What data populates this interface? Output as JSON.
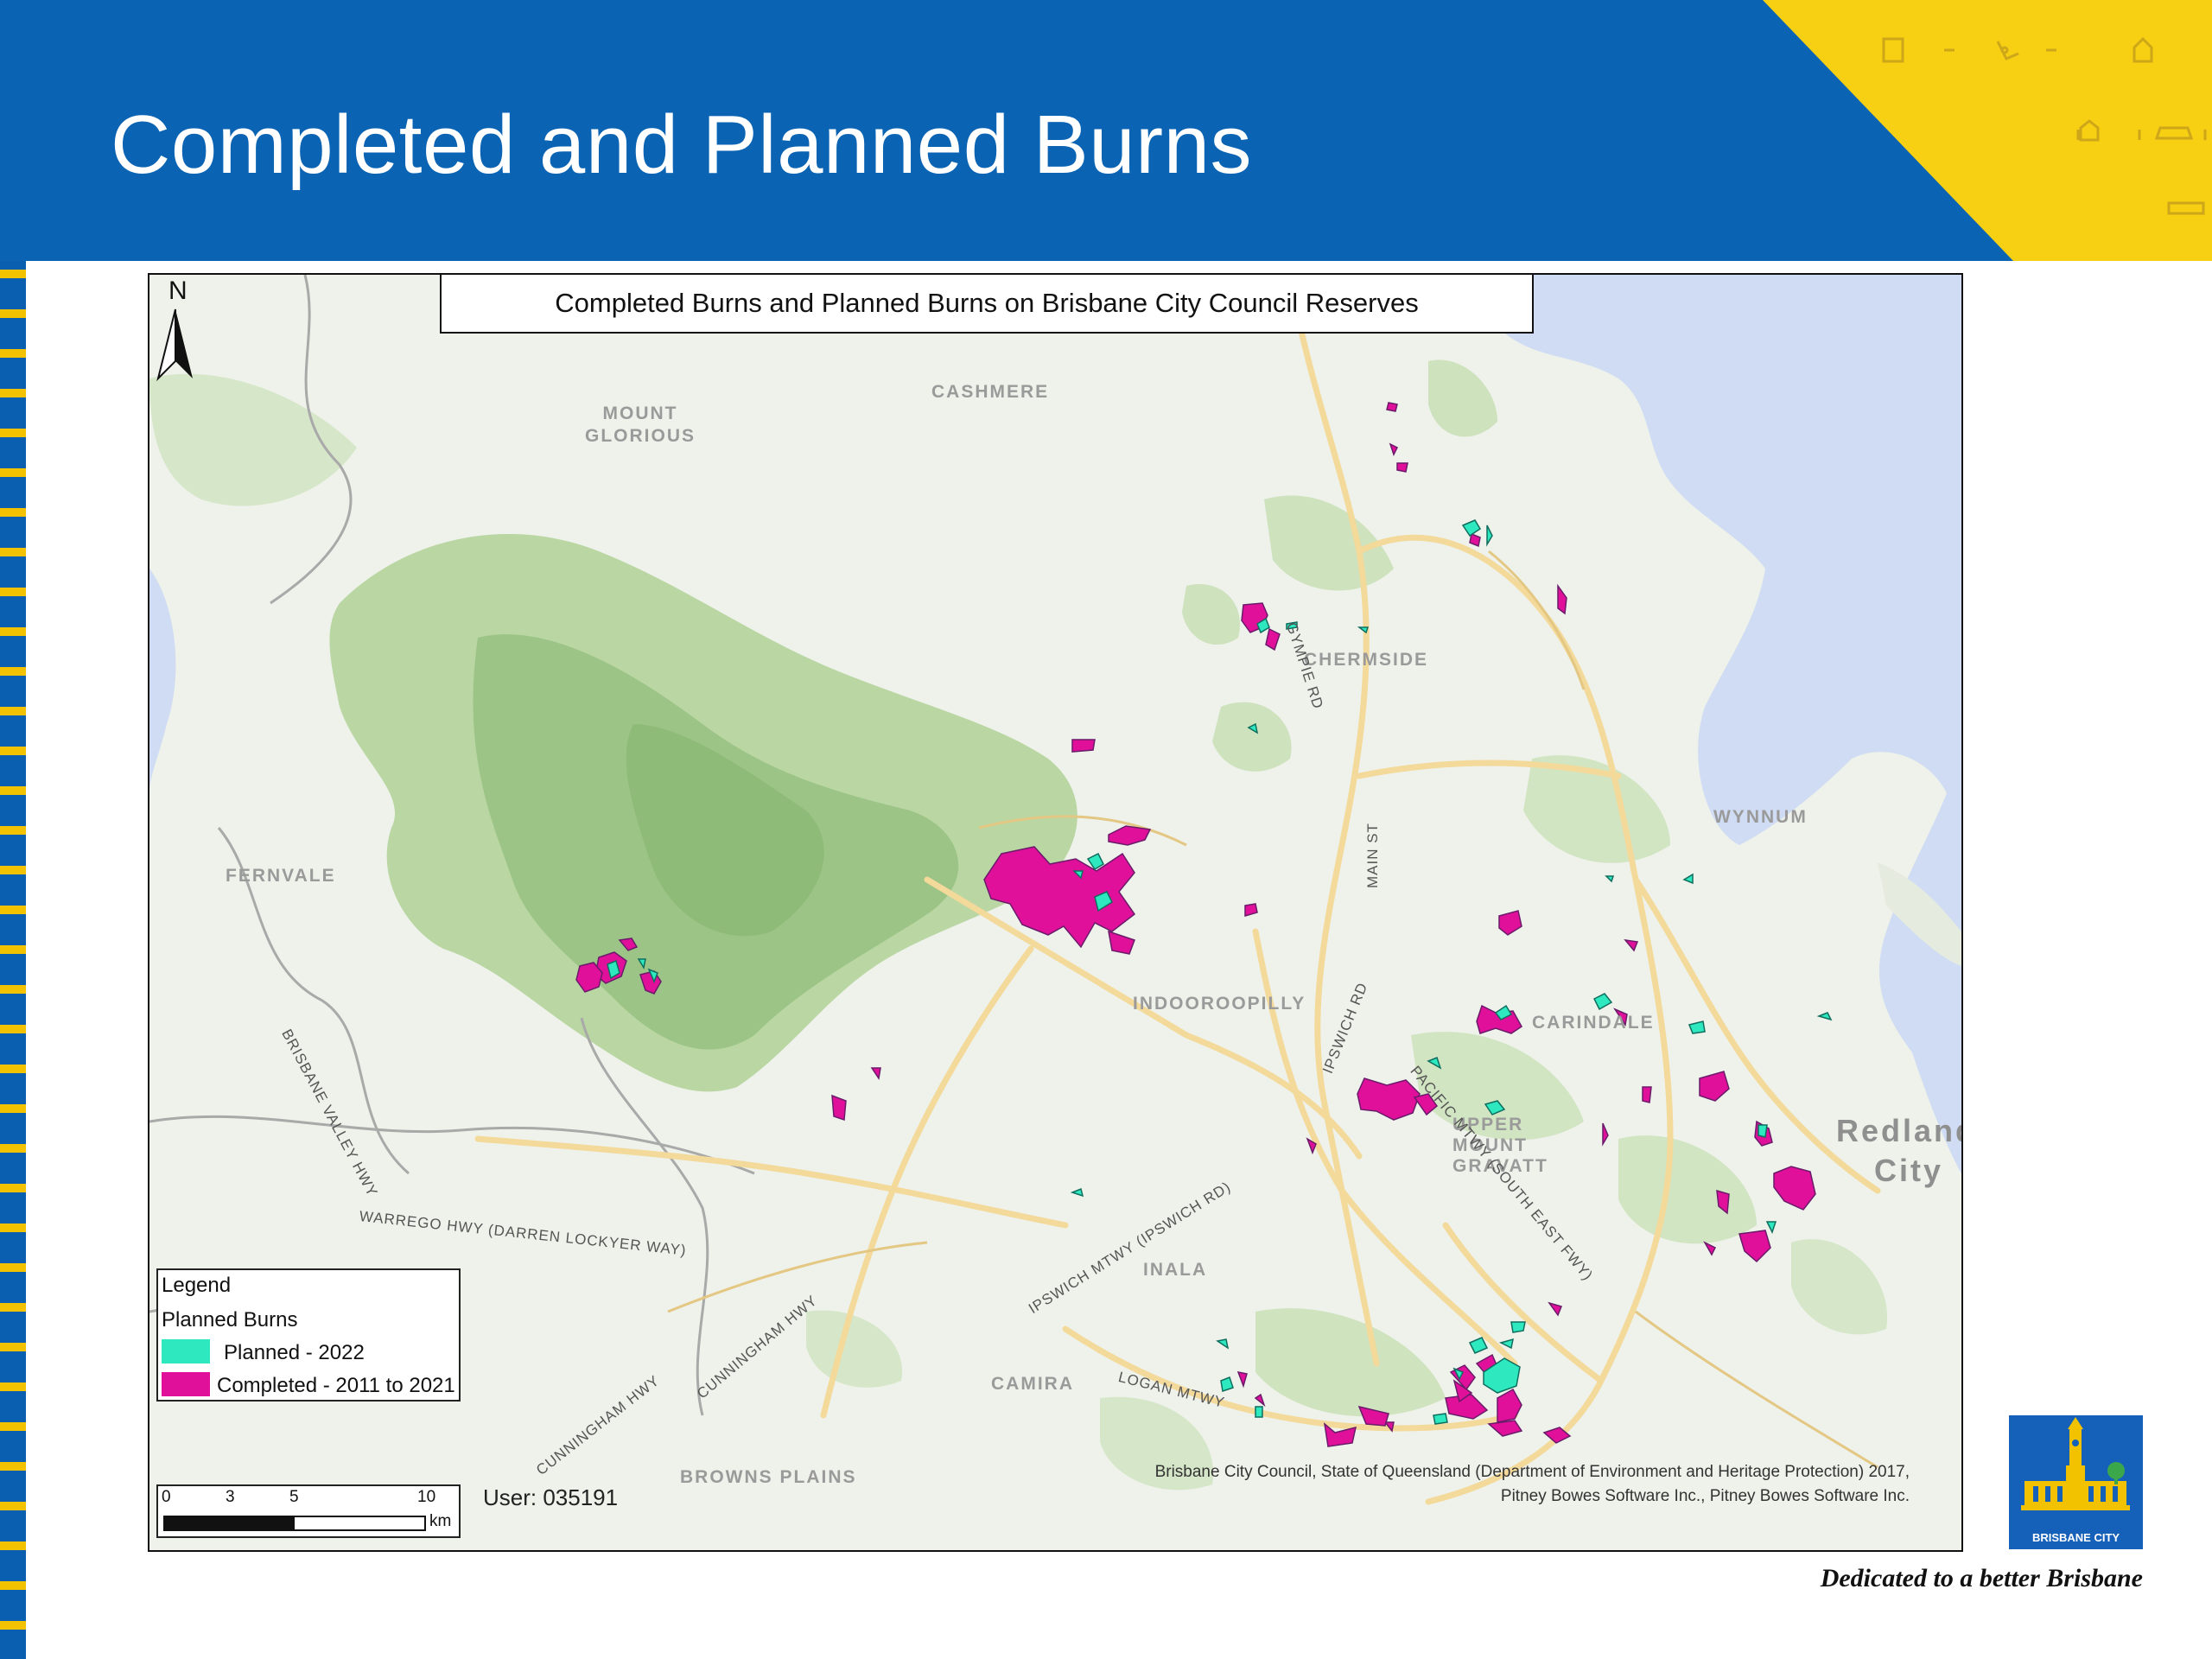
{
  "slide": {
    "title": "Completed and Planned Burns",
    "colors": {
      "header_blue": "#0a63b3",
      "accent_yellow": "#f7cf13"
    }
  },
  "map": {
    "title": "Completed Burns and Planned Burns on Brisbane City Council Reserves",
    "north_label": "N",
    "legend": {
      "heading": "Legend",
      "subheading": "Planned Burns",
      "items": [
        {
          "label": "Planned - 2022",
          "color": "#2ee8c0"
        },
        {
          "label": "Completed - 2011 to 2021",
          "color": "#e0109a"
        }
      ]
    },
    "scale": {
      "ticks": [
        "0",
        "3",
        "5",
        "10"
      ],
      "unit": "km"
    },
    "user": "User: 035191",
    "attribution_line1": "Brisbane City Council, State of Queensland (Department of Environment and Heritage Protection) 2017,",
    "attribution_line2": "Pitney Bowes Software Inc., Pitney Bowes Software Inc.",
    "place_labels": [
      "CASHMERE",
      "MOUNT GLORIOUS",
      "CHERMSIDE",
      "WYNNUM",
      "FERNVALE",
      "INDOOROOPILLY",
      "CARINDALE",
      "UPPER MOUNT GRAVATT",
      "INALA",
      "CAMIRA",
      "BROWNS PLAINS"
    ],
    "large_labels": [
      "Redland",
      "City"
    ],
    "road_labels": [
      "GYMPIE RD",
      "MAIN ST",
      "IPSWICH RD",
      "PACIFIC MTWY (SOUTH EAST FWY)",
      "IPSWICH MTWY (IPSWICH RD)",
      "LOGAN MTWY",
      "BRISBANE VALLEY HWY",
      "WARREGO HWY (DARREN LOCKYER WAY)",
      "CUNNINGHAM HWY",
      "CUNNINGHAM HWY"
    ]
  },
  "footer": {
    "logo_text": "BRISBANE CITY",
    "tagline": "Dedicated to a better Brisbane"
  }
}
